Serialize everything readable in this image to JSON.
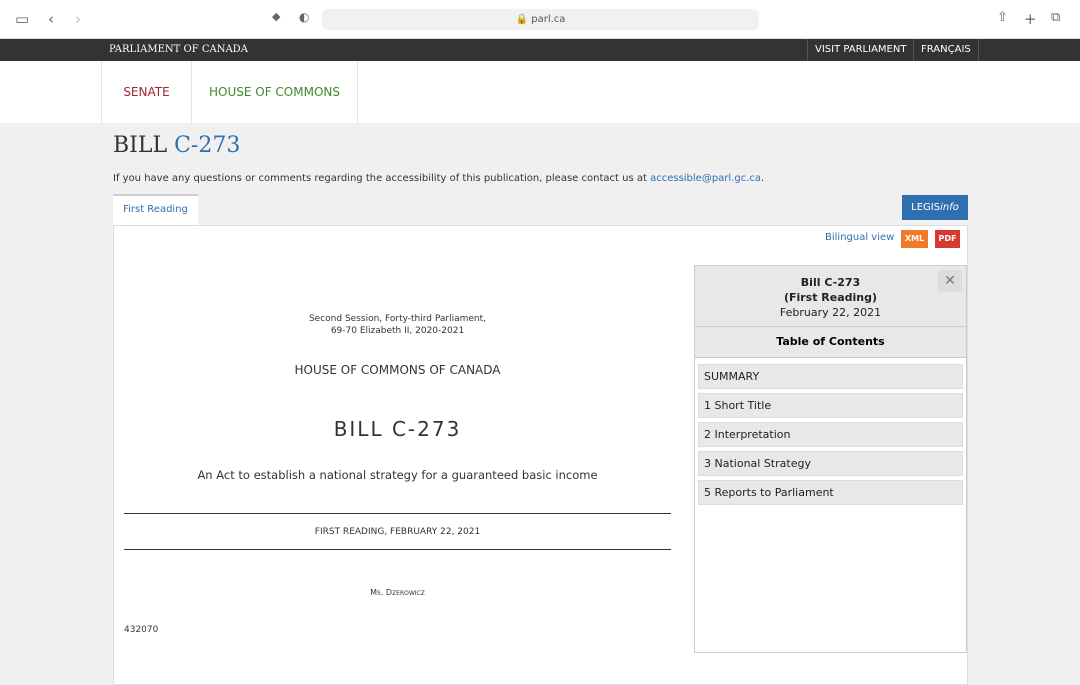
{
  "browser": {
    "url": "parl.ca"
  },
  "topbar": {
    "brand": "PARLIAMENT OF CANADA",
    "visit": "VISIT PARLIAMENT",
    "lang": "FRANÇAIS"
  },
  "nav": {
    "senate": "SENATE",
    "commons": "HOUSE OF COMMONS",
    "senate_color": "#a0282d",
    "commons_color": "#3f8a2e"
  },
  "page": {
    "title_prefix": "BILL",
    "title_bill": "C-273",
    "accessibility_text": "If you have any questions or comments regarding the accessibility of this publication, please contact us at",
    "accessibility_email": "accessible@parl.gc.ca",
    "accessibility_end": ".",
    "tab": "First Reading",
    "legis_a": "LEGIS",
    "legis_b": "info"
  },
  "toolbar": {
    "bilingual": "Bilingual view",
    "xml": "XML",
    "pdf": "PDF"
  },
  "doc": {
    "session": "Second Session, Forty-third Parliament,",
    "reign": "69-70 Elizabeth II, 2020-2021",
    "house": "HOUSE OF COMMONS OF CANADA",
    "bill": "BILL C-273",
    "act": "An Act to establish a national strategy for a guaranteed basic income",
    "reading": "FIRST READING, FEBRUARY 22, 2021",
    "sponsor": "Ms. Dzerowicz",
    "number": "432070"
  },
  "toc": {
    "bill": "Bill C-273",
    "stage": "(First Reading)",
    "date": "February 22, 2021",
    "heading": "Table of Contents",
    "items": [
      "SUMMARY",
      "1 Short Title",
      "2 Interpretation",
      "3 National Strategy",
      "5 Reports to Parliament"
    ]
  }
}
